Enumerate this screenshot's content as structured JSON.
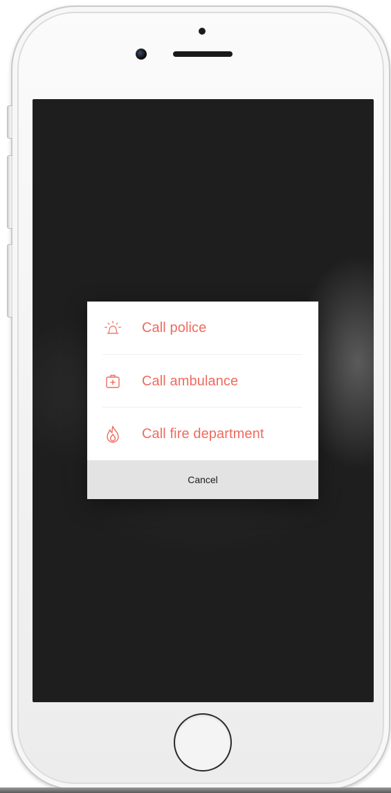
{
  "device": {
    "type": "phone",
    "color": "#f4f4f4",
    "screen_color": "#1e1e1e"
  },
  "action_sheet": {
    "accent_color": "#ef6a5d",
    "options": [
      {
        "label": "Call police",
        "icon": "siren-icon"
      },
      {
        "label": "Call ambulance",
        "icon": "medical-kit-icon"
      },
      {
        "label": "Call fire department",
        "icon": "flame-icon"
      }
    ],
    "cancel_label": "Cancel",
    "cancel_background": "#e3e3e3"
  }
}
